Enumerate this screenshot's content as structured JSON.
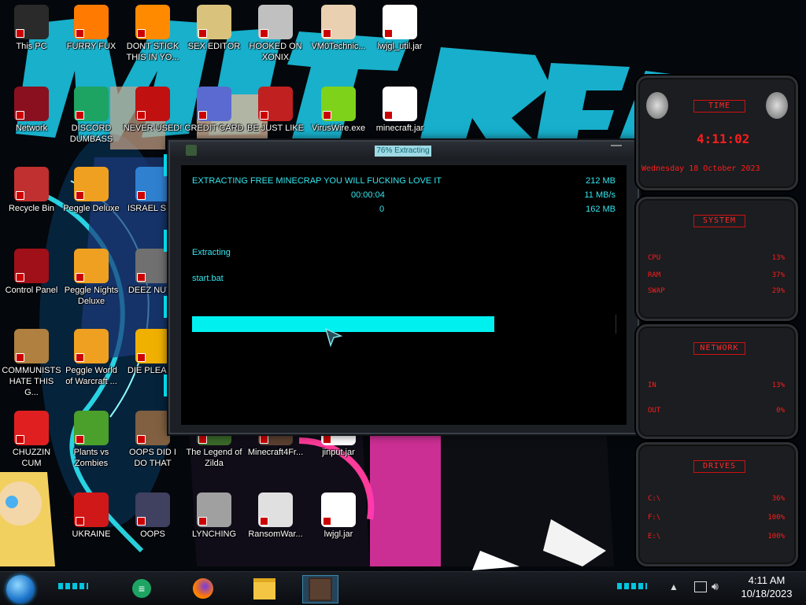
{
  "desktop": {
    "icons": [
      {
        "label": "This PC",
        "icon": "this-pc-icon",
        "color": "#2a2a2a"
      },
      {
        "label": "FURRY FUX",
        "icon": "firefox-icon",
        "color": "#ff7a00"
      },
      {
        "label": "DONT STICK\nTHIS IN YO...",
        "icon": "vlc-icon",
        "color": "#ff8a00"
      },
      {
        "label": "SEX EDITOR",
        "icon": "hxd-icon",
        "color": "#d9c27c"
      },
      {
        "label": "HOOKED ON\nXONIX",
        "icon": "xonix-icon",
        "color": "#c0c0c0"
      },
      {
        "label": "VM0Technic...",
        "icon": "doctor-icon",
        "color": "#e8d0b0"
      },
      {
        "label": "lwjgl_util.jar",
        "icon": "java-icon",
        "color": "#ffffff"
      },
      {
        "label": "Network",
        "icon": "network-icon",
        "color": "#8a1020"
      },
      {
        "label": "DISCORD\nDUMBASS",
        "icon": "spreadsheet-icon",
        "color": "#1da463"
      },
      {
        "label": "NEVER USED!",
        "icon": "dev-cpp-icon",
        "color": "#c01010"
      },
      {
        "label": "CREDIT CARD",
        "icon": "credit-card-icon",
        "color": "#5a6ad0"
      },
      {
        "label": "BE JUST LIKE",
        "icon": "santa-icon",
        "color": "#c02020"
      },
      {
        "label": "VirusWire.exe",
        "icon": "lime-icon",
        "color": "#7fd21a"
      },
      {
        "label": "minecraft.jar",
        "icon": "java-icon",
        "color": "#ffffff"
      },
      {
        "label": "Recycle Bin",
        "icon": "recycle-bin-icon",
        "color": "#c03030"
      },
      {
        "label": "Peggle Deluxe",
        "icon": "peggle-icon",
        "color": "#f0a020"
      },
      {
        "label": "ISRAEL SP...",
        "icon": "flag-icon",
        "color": "#3080d0"
      },
      {
        "label": "Control Panel",
        "icon": "control-panel-icon",
        "color": "#a01018"
      },
      {
        "label": "Peggle Nights\nDeluxe",
        "icon": "peggle-icon",
        "color": "#f0a020"
      },
      {
        "label": "DEEZ NUTS",
        "icon": "folder-stack-icon",
        "color": "#707070"
      },
      {
        "label": "COMMUNISTS\nHATE THIS G...",
        "icon": "money-bag-icon",
        "color": "#b08040"
      },
      {
        "label": "Peggle World\nof Warcraft ...",
        "icon": "peggle-icon",
        "color": "#f0a020"
      },
      {
        "label": "DIE PLEASE",
        "icon": "die-icon",
        "color": "#f0b000"
      },
      {
        "label": "CHUZZIN\nCUM",
        "icon": "chuzzle-icon",
        "color": "#e02020"
      },
      {
        "label": "Plants vs\nZombies",
        "icon": "plants-icon",
        "color": "#4aa02a"
      },
      {
        "label": "OOPS DID I\nDO THAT",
        "icon": "portrait-icon",
        "color": "#806040"
      },
      {
        "label": "The Legend of\nZilda",
        "icon": "zelda-icon",
        "color": "#3a6a2a"
      },
      {
        "label": "Minecraft4Fr...",
        "icon": "minecraft-icon",
        "color": "#5a4030"
      },
      {
        "label": "jinput.jar",
        "icon": "java-icon",
        "color": "#ffffff"
      },
      {
        "label": "UKRAINE",
        "icon": "radiation-icon",
        "color": "#d01818"
      },
      {
        "label": "OOPS",
        "icon": "book-icon",
        "color": "#404060"
      },
      {
        "label": "LYNCHING",
        "icon": "gear-flag-icon",
        "color": "#a0a0a0"
      },
      {
        "label": "RansomWar...",
        "icon": "skull-icon",
        "color": "#e0e0e0"
      },
      {
        "label": "lwjgl.jar",
        "icon": "java-icon",
        "color": "#ffffff"
      }
    ]
  },
  "dialog": {
    "title": "76% Extracting",
    "message": "EXTRACTING FREE MINECRAP YOU WILL FUCKING LOVE IT",
    "elapsed": "00:00:04",
    "processed": "0",
    "total_size": "212 MB",
    "speed": "11 MB/s",
    "packed_size": "162 MB",
    "status": "Extracting",
    "current_file": "start.bat",
    "progress": 0.76
  },
  "gadget": {
    "time_title": "TIME",
    "clock": "4:11:02",
    "date": "Wednesday 18 October 2023",
    "system_title": "SYSTEM",
    "system_rows": [
      {
        "label": "CPU",
        "value": "13%"
      },
      {
        "label": "RAM",
        "value": "37%"
      },
      {
        "label": "SWAP",
        "value": "29%"
      }
    ],
    "network_title": "NETWORK",
    "network_rows": [
      {
        "label": "IN",
        "value": "13%"
      },
      {
        "label": "OUT",
        "value": "0%"
      }
    ],
    "drives_title": "DRIVES",
    "drive_rows": [
      {
        "label": "C:\\",
        "value": "36%"
      },
      {
        "label": "F:\\",
        "value": "100%"
      },
      {
        "label": "E:\\",
        "value": "100%"
      }
    ],
    "accent_color": "#ff1c1c"
  },
  "taskbar": {
    "apps": [
      {
        "name": "spreadsheet-icon",
        "active": false
      },
      {
        "name": "firefox-icon",
        "active": false
      },
      {
        "name": "file-explorer-icon",
        "active": false
      },
      {
        "name": "minecraft-icon",
        "active": true
      }
    ],
    "tray_time": "4:11 AM",
    "tray_date": "10/18/2023"
  }
}
